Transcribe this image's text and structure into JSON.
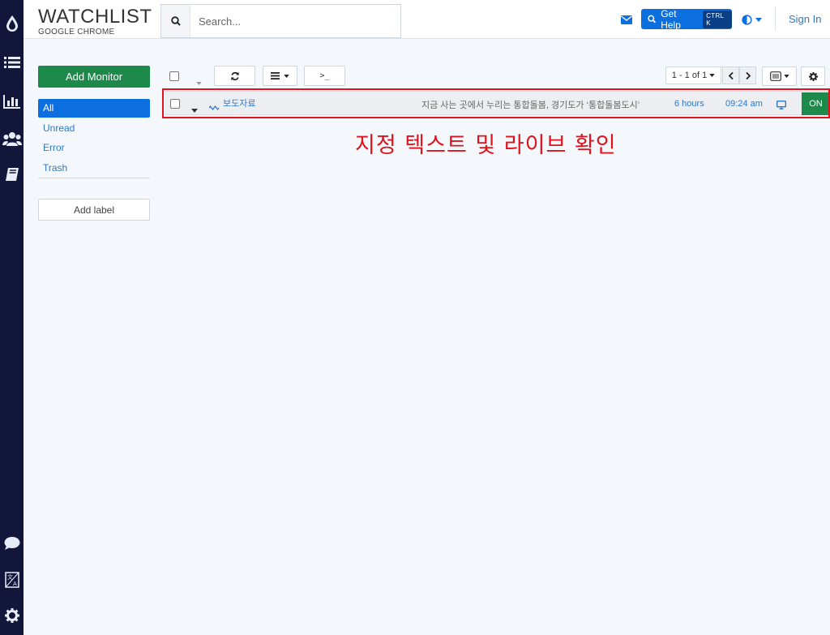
{
  "header": {
    "title": "WATCHLIST",
    "subtitle": "GOOGLE CHROME",
    "search_placeholder": "Search...",
    "help_label": "Get Help",
    "help_shortcut": "CTRL K",
    "signin_label": "Sign In"
  },
  "sidebar": {
    "add_monitor_label": "Add Monitor",
    "items": [
      {
        "label": "All",
        "active": true
      },
      {
        "label": "Unread",
        "active": false
      },
      {
        "label": "Error",
        "active": false
      },
      {
        "label": "Trash",
        "active": false
      }
    ],
    "add_label": "Add label"
  },
  "toolbar": {
    "pagination": "1 - 1 of 1",
    "terminal_label": ">_"
  },
  "monitor": {
    "name": "보도자료",
    "text": "지금 사는 곳에서 누리는 통합돌봄, 경기도가 ‘통합돌봄도시’",
    "frequency": "6 hours",
    "time": "09:24 am",
    "status": "ON"
  },
  "annotation": "지정 텍스트 및 라이브 확인",
  "colors": {
    "rail": "#12163a",
    "accent_blue": "#0b6fe0",
    "green": "#1d8a4c",
    "highlight_red": "#e0121b"
  },
  "icons": {
    "rail": [
      "drop-icon",
      "list-icon",
      "chart-icon",
      "users-icon",
      "book-icon",
      "chat-icon",
      "translate-icon",
      "gear-icon"
    ]
  }
}
